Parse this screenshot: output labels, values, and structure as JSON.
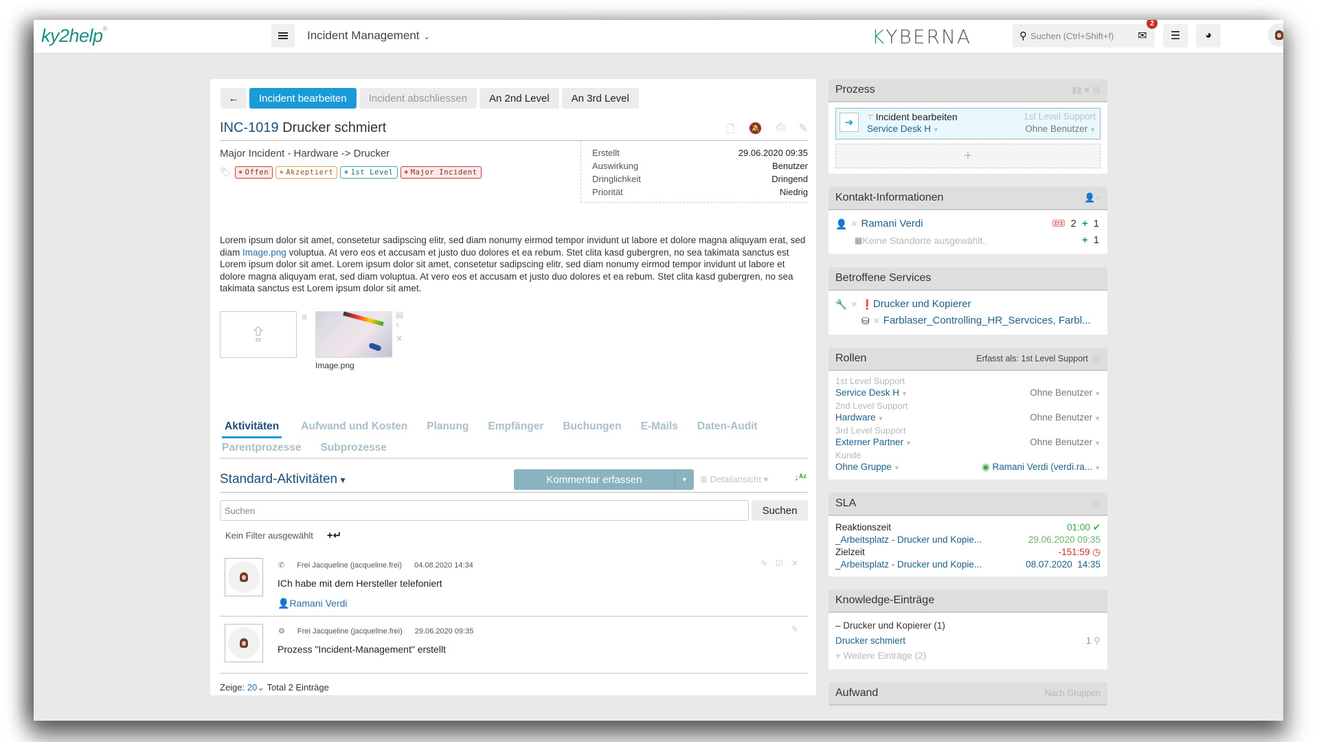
{
  "header": {
    "logo": "ky2help",
    "logo_mark": "®",
    "menu_icon": "hamburger-icon",
    "app_name": "Incident Management",
    "brand": "KYBERNA",
    "search_placeholder": "Suchen (Ctrl+Shift+f)",
    "mail_badge": "2"
  },
  "toolbar": {
    "back_icon": "arrow-left-icon",
    "buttons": [
      "Incident bearbeiten",
      "Incident abschliessen",
      "An 2nd Level",
      "An 3rd Level"
    ]
  },
  "ticket": {
    "id": "INC-1019",
    "title": "Drucker schmiert",
    "category": "Major Incident - Hardware -> Drucker",
    "tags": [
      {
        "label": "Offen",
        "style": "red"
      },
      {
        "label": "Akzeptiert",
        "style": "orange"
      },
      {
        "label": "1st Level",
        "style": "teal"
      },
      {
        "label": "Major Incident",
        "style": "red"
      }
    ],
    "meta": [
      {
        "key": "Erstellt",
        "value": "29.06.2020 09:35"
      },
      {
        "key": "Auswirkung",
        "value": "Benutzer"
      },
      {
        "key": "Dringlichkeit",
        "value": "Dringend"
      },
      {
        "key": "Priorität",
        "value": "Niedrig"
      }
    ],
    "description_pre": "Lorem ipsum dolor sit amet, consetetur sadipscing elitr, sed diam nonumy eirmod tempor invidunt ut labore et dolore magna aliquyam erat, sed diam ",
    "description_link": "Image.png",
    "description_post": " voluptua. At vero eos et accusam et justo duo dolores et ea rebum. Stet clita kasd gubergren, no sea takimata sanctus est Lorem ipsum dolor sit amet. Lorem ipsum dolor sit amet, consetetur sadipscing elitr, sed diam nonumy eirmod tempor invidunt ut labore et dolore magna aliquyam erat, sed diam voluptua. At vero eos et accusam et justo duo dolores et ea rebum. Stet clita kasd gubergren, no sea takimata sanctus est Lorem ipsum dolor sit amet.",
    "attachment_name": "Image.png"
  },
  "tabs": {
    "row1": [
      "Aktivitäten",
      "Aufwand und Kosten",
      "Planung",
      "Empfänger",
      "Buchungen",
      "E-Mails",
      "Daten-Audit"
    ],
    "row2": [
      "Parentprozesse",
      "Subprozesse"
    ],
    "active": "Aktivitäten"
  },
  "activities": {
    "title": "Standard-Aktivitäten",
    "comment_button": "Kommentar erfassen",
    "detail_view": "Detailansicht",
    "search_placeholder": "Suchen",
    "search_button": "Suchen",
    "filter_text": "Kein Filter ausgewählt",
    "items": [
      {
        "icon": "phone-icon",
        "author": "Frei Jacqueline (jacqueline.frei)",
        "date": "04.08.2020 14:34",
        "text": "ICh habe mit dem Hersteller telefoniert",
        "person": "Ramani Verdi"
      },
      {
        "icon": "cogs-icon",
        "author": "Frei Jacqueline (jacqueline.frei)",
        "date": "29.06.2020 09:35",
        "text": "Prozess \"Incident-Management\" erstellt"
      }
    ],
    "footer_show_label": "Zeige:",
    "footer_show_value": "20",
    "footer_total": "Total 2 Einträge"
  },
  "process_panel": {
    "title": "Prozess",
    "step_name": "Incident bearbeiten",
    "step_group": "Service Desk H",
    "step_level": "1st Level Support",
    "step_user": "Ohne Benutzer"
  },
  "contact_panel": {
    "title": "Kontakt-Informationen",
    "name": "Ramani Verdi",
    "tickets_count": "2",
    "plus_count_1": "1",
    "no_location": "Keine Standorte ausgewählt.",
    "plus_count_2": "1"
  },
  "services_panel": {
    "title": "Betroffene Services",
    "service": "Drucker und Kopierer",
    "ci": "Farblaser_Controlling_HR_Servcices, Farbl..."
  },
  "roles_panel": {
    "title": "Rollen",
    "captured_as": "Erfasst als: 1st Level Support",
    "roles": [
      {
        "label": "1st Level Support",
        "group": "Service Desk H",
        "user": "Ohne Benutzer"
      },
      {
        "label": "2nd Level Support",
        "group": "Hardware",
        "user": "Ohne Benutzer"
      },
      {
        "label": "3rd Level Support",
        "group": "Externer Partner",
        "user": "Ohne Benutzer"
      },
      {
        "label": "Kunde",
        "group": "Ohne Gruppe",
        "user": "Ramani Verdi (verdi.ra..."
      }
    ]
  },
  "sla_panel": {
    "title": "SLA",
    "rows": [
      {
        "label": "Reaktionszeit",
        "value": "01:00",
        "status": "ok",
        "sub": "_Arbeitsplatz - Drucker und Kopie...",
        "date": "29.06.2020 09:35"
      },
      {
        "label": "Zielzeit",
        "value": "-151:59",
        "status": "overdue",
        "sub": "_Arbeitsplatz - Drucker und Kopie...",
        "date": "08.07.2020  14:35"
      }
    ],
    "colors": {
      "ok": "#3aa845",
      "overdue": "#c9302c"
    }
  },
  "knowledge_panel": {
    "title": "Knowledge-Einträge",
    "group": "Drucker und Kopierer (1)",
    "entry": "Drucker schmiert",
    "entry_count": "1",
    "more": "Weitere Einträge (2)"
  },
  "effort_panel": {
    "title": "Aufwand",
    "mode": "Nach Gruppen"
  },
  "colors": {
    "primary": "#1a9ad6",
    "brand_teal": "#1b8f80",
    "link": "#1e5f8a"
  }
}
